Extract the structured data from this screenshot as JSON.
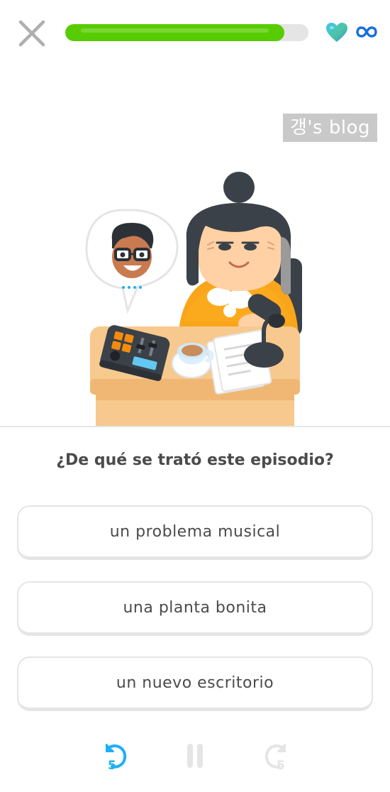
{
  "header": {
    "close_icon": "close-icon",
    "progress": 0.9,
    "progress_color": "#58cc02",
    "hearts_icon": "heart-icon",
    "hearts_count_icon": "infinity-icon"
  },
  "watermark": {
    "text": "갱's blog"
  },
  "illustration": {
    "description_icon": "podcast-host-illustration"
  },
  "question": {
    "text": "¿De qué se trató este episodio?"
  },
  "choices": [
    {
      "label": "un problema musical"
    },
    {
      "label": "una planta bonita"
    },
    {
      "label": "un nuevo escritorio"
    }
  ],
  "playback": {
    "rewind_label": "5",
    "forward_label": "5",
    "rewind_icon": "rewind-5-icon",
    "pause_icon": "pause-icon",
    "forward_icon": "forward-5-icon",
    "accent": "#1cb0f6",
    "disabled": "#e5e5e5"
  }
}
